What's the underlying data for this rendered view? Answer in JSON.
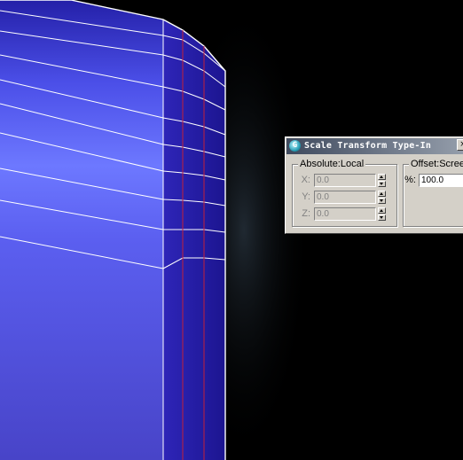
{
  "dialog": {
    "title": "Scale Transform Type-In",
    "icon_glyph": "G",
    "close_glyph": "×",
    "absolute_group": {
      "label": "Absolute:Local",
      "rows": [
        {
          "axis": "X:",
          "value": "0.0"
        },
        {
          "axis": "Y:",
          "value": "0.0"
        },
        {
          "axis": "Z:",
          "value": "0.0"
        }
      ]
    },
    "offset_group": {
      "label": "Offset:Screen",
      "percent_label": "%:",
      "percent_value": "100.0"
    }
  },
  "colors": {
    "mesh_light": "#6c78ff",
    "mesh_dark": "#2a1fa3",
    "wire": "#ffffff",
    "seam": "#c0203a"
  }
}
